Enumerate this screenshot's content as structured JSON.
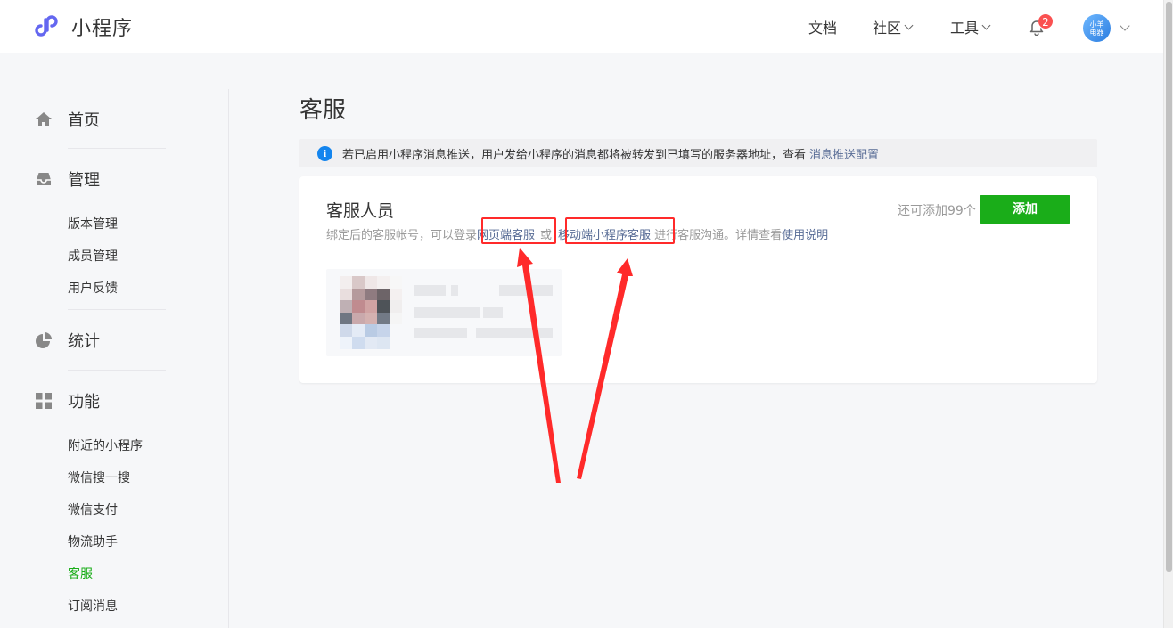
{
  "header": {
    "app_title": "小程序",
    "nav_docs": "文档",
    "nav_community": "社区",
    "nav_tools": "工具",
    "notification_count": "2",
    "avatar_text_line1": "小羊",
    "avatar_text_line2": "电器"
  },
  "sidebar": {
    "home": "首页",
    "manage": "管理",
    "manage_items": [
      "版本管理",
      "成员管理",
      "用户反馈"
    ],
    "stats": "统计",
    "features": "功能",
    "feature_items": [
      "附近的小程序",
      "微信搜一搜",
      "微信支付",
      "物流助手",
      "客服",
      "订阅消息"
    ],
    "active_item": "客服"
  },
  "main": {
    "page_title": "客服",
    "notice_text": "若已启用小程序消息推送，用户发给小程序的消息都将被转发到已填写的服务器地址，查看",
    "notice_link": "消息推送配置",
    "card_title": "客服人员",
    "desc_prefix": "绑定后的客服帐号，可以登录",
    "desc_link_web": "网页端客服",
    "desc_or": "或",
    "desc_link_mobile": "移动端小程序客服",
    "desc_middle": "进行客服沟通。详情查看",
    "desc_link_help": "使用说明",
    "remain_text": "还可添加99个",
    "add_button": "添加"
  },
  "colors": {
    "accent_green": "#1aad19",
    "link_blue": "#576b95",
    "highlight_red": "#ff2a2a",
    "badge_red": "#fa5151",
    "info_blue": "#1485ee"
  }
}
